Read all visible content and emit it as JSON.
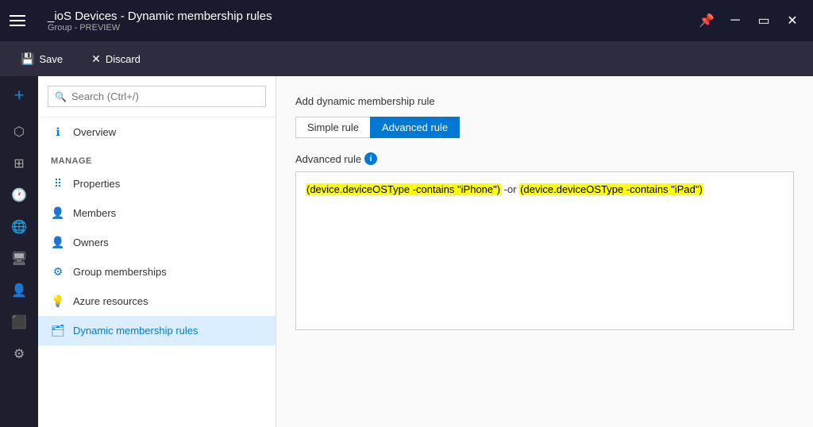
{
  "titleBar": {
    "title": "_ioS Devices - Dynamic membership rules",
    "subtitle": "Group - PREVIEW",
    "controls": {
      "pin": "📌",
      "minimize": "─",
      "maximize": "□",
      "close": "✕"
    }
  },
  "toolbar": {
    "save_label": "Save",
    "discard_label": "Discard"
  },
  "search": {
    "placeholder": "Search (Ctrl+/)"
  },
  "nav": {
    "overview_label": "Overview",
    "manage_section": "MANAGE",
    "items": [
      {
        "label": "Properties",
        "icon": "⠿"
      },
      {
        "label": "Members",
        "icon": "👤"
      },
      {
        "label": "Owners",
        "icon": "👤"
      },
      {
        "label": "Group memberships",
        "icon": "⚙"
      },
      {
        "label": "Azure resources",
        "icon": "💡"
      },
      {
        "label": "Dynamic membership rules",
        "icon": "🗂",
        "active": true
      }
    ]
  },
  "main": {
    "add_rule_label": "Add dynamic membership rule",
    "tab_simple": "Simple rule",
    "tab_advanced": "Advanced rule",
    "advanced_rule_label": "Advanced rule",
    "rule_text": "(device.deviceOSType -contains \"iPhone\") -or (device.deviceOSType -contains \"iPad\")"
  }
}
